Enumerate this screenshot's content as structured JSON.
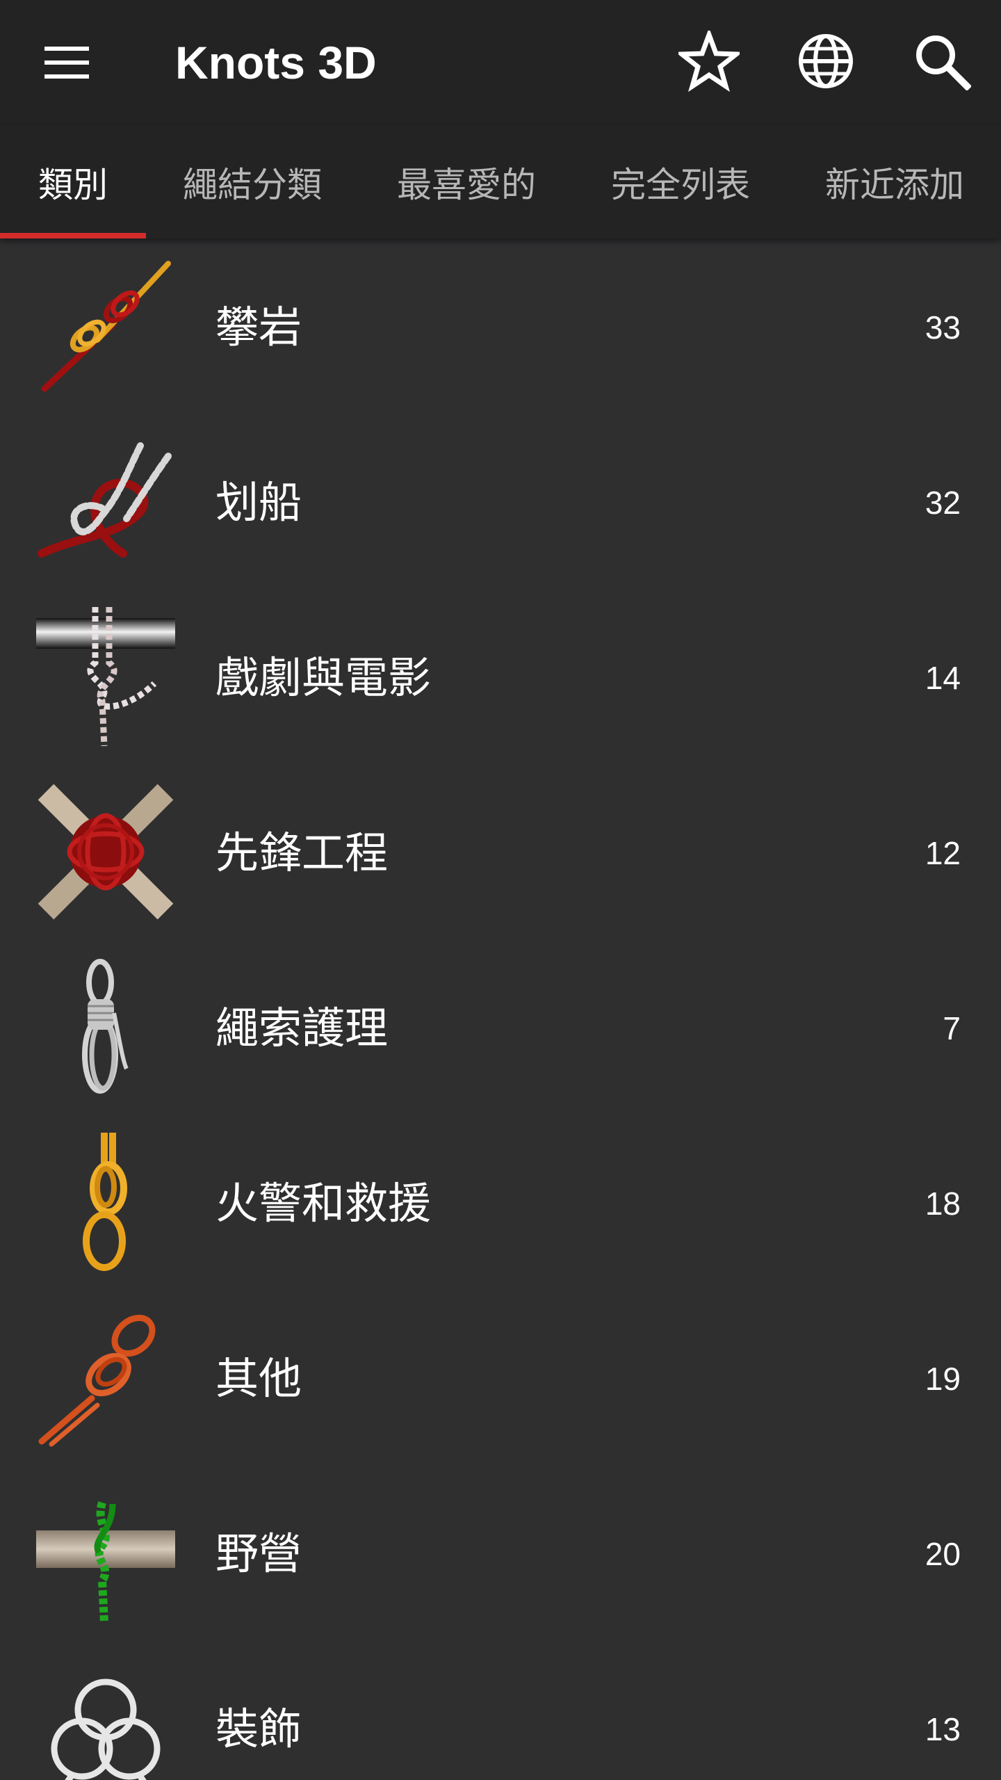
{
  "appbar": {
    "title": "Knots 3D",
    "icons": [
      "menu-icon",
      "star-icon",
      "globe-icon",
      "search-icon"
    ]
  },
  "tabs": [
    {
      "label": "類別",
      "active": true
    },
    {
      "label": "繩結分類",
      "active": false
    },
    {
      "label": "最喜愛的",
      "active": false
    },
    {
      "label": "完全列表",
      "active": false
    },
    {
      "label": "新近添加",
      "active": false
    }
  ],
  "categories": [
    {
      "label": "攀岩",
      "count": "33",
      "icon": "climbing-knot-icon"
    },
    {
      "label": "划船",
      "count": "32",
      "icon": "boating-knot-icon"
    },
    {
      "label": "戲劇與電影",
      "count": "14",
      "icon": "theatre-knot-icon"
    },
    {
      "label": "先鋒工程",
      "count": "12",
      "icon": "lashing-knot-icon"
    },
    {
      "label": "繩索護理",
      "count": "7",
      "icon": "rope-coil-icon"
    },
    {
      "label": "火警和救援",
      "count": "18",
      "icon": "rescue-knot-icon"
    },
    {
      "label": "其他",
      "count": "19",
      "icon": "figure-eight-knot-icon"
    },
    {
      "label": "野營",
      "count": "20",
      "icon": "camping-knot-icon"
    },
    {
      "label": "裝飾",
      "count": "13",
      "icon": "decorative-knot-icon"
    }
  ],
  "colors": {
    "appbar_bg": "#232324",
    "list_bg": "#2f2f30",
    "accent": "#d42b2b",
    "tab_inactive": "#b7b7b7"
  }
}
